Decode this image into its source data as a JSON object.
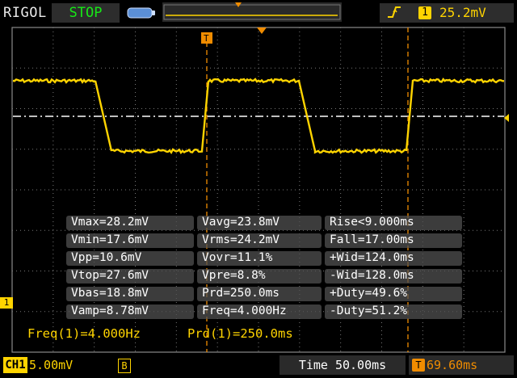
{
  "header": {
    "brand": "RIGOL",
    "run_state": "STOP",
    "trigger": {
      "slope": "rising",
      "channel": "1",
      "level": "25.2mV"
    }
  },
  "channel": {
    "marker": "1",
    "label": "CH1",
    "scale": "5.00mV",
    "bw_limit": "B"
  },
  "timebase": {
    "time": "Time 50.00ms",
    "offset": "69.60ms"
  },
  "measurements": [
    [
      "Vmax=28.2mV",
      "Vavg=23.8mV",
      "Rise<9.000ms"
    ],
    [
      "Vmin=17.6mV",
      "Vrms=24.2mV",
      "Fall=17.00ms"
    ],
    [
      "Vpp=10.6mV",
      "Vovr=11.1%",
      "+Wid=124.0ms"
    ],
    [
      "Vtop=27.6mV",
      "Vpre=8.8%",
      "-Wid=128.0ms"
    ],
    [
      "Vbas=18.8mV",
      "Prd=250.0ms",
      "+Duty=49.6%"
    ],
    [
      "Vamp=8.78mV",
      "Freq=4.000Hz",
      "-Duty=51.2%"
    ]
  ],
  "counter": {
    "freq": "Freq(1)=4.000Hz",
    "period": "Prd(1)=250.0ms"
  },
  "colors": {
    "channel1": "#ffd400",
    "trigger_marker": "#f08c00",
    "run_state": "#17e817",
    "grid": "#9a9a9a"
  }
}
